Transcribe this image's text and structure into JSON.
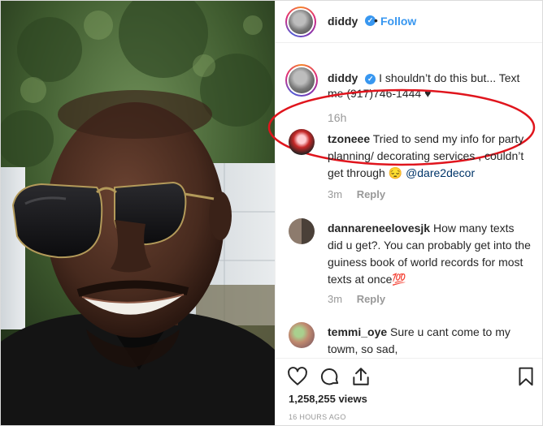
{
  "post": {
    "username": "diddy",
    "follow_label": "Follow",
    "separator": "•",
    "caption": {
      "username": "diddy",
      "text": "I shouldn’t do this but... Text me (917)746-1444",
      "time": "16h"
    },
    "comments": [
      {
        "username": "tzoneee",
        "text": "Tried to send my info for party planning/ decorating services , couldn’t get through",
        "emoji": "😔",
        "mention": "@dare2decor",
        "time": "3m",
        "reply_label": "Reply"
      },
      {
        "username": "dannareneelovesjk",
        "text": "How many texts did u get?. You can probably get into the guiness book of world records for most texts at once",
        "emoji": "💯",
        "time": "3m",
        "reply_label": "Reply"
      },
      {
        "username": "temmi_oye",
        "text": "Sure u cant come to my towm, so sad, NGNGNGNGNGNGNGNG"
      }
    ],
    "views": "1,258,255 views",
    "posted": "16 HOURS AGO"
  },
  "icons": [
    "verified-badge-icon",
    "heart-outline-icon",
    "comment-bubble-icon",
    "share-plane-icon",
    "bookmark-icon",
    "black-heart-emoji"
  ],
  "colors": {
    "link_blue": "#3897f0",
    "highlight_red": "#e0151d",
    "muted_gray": "#999999"
  }
}
